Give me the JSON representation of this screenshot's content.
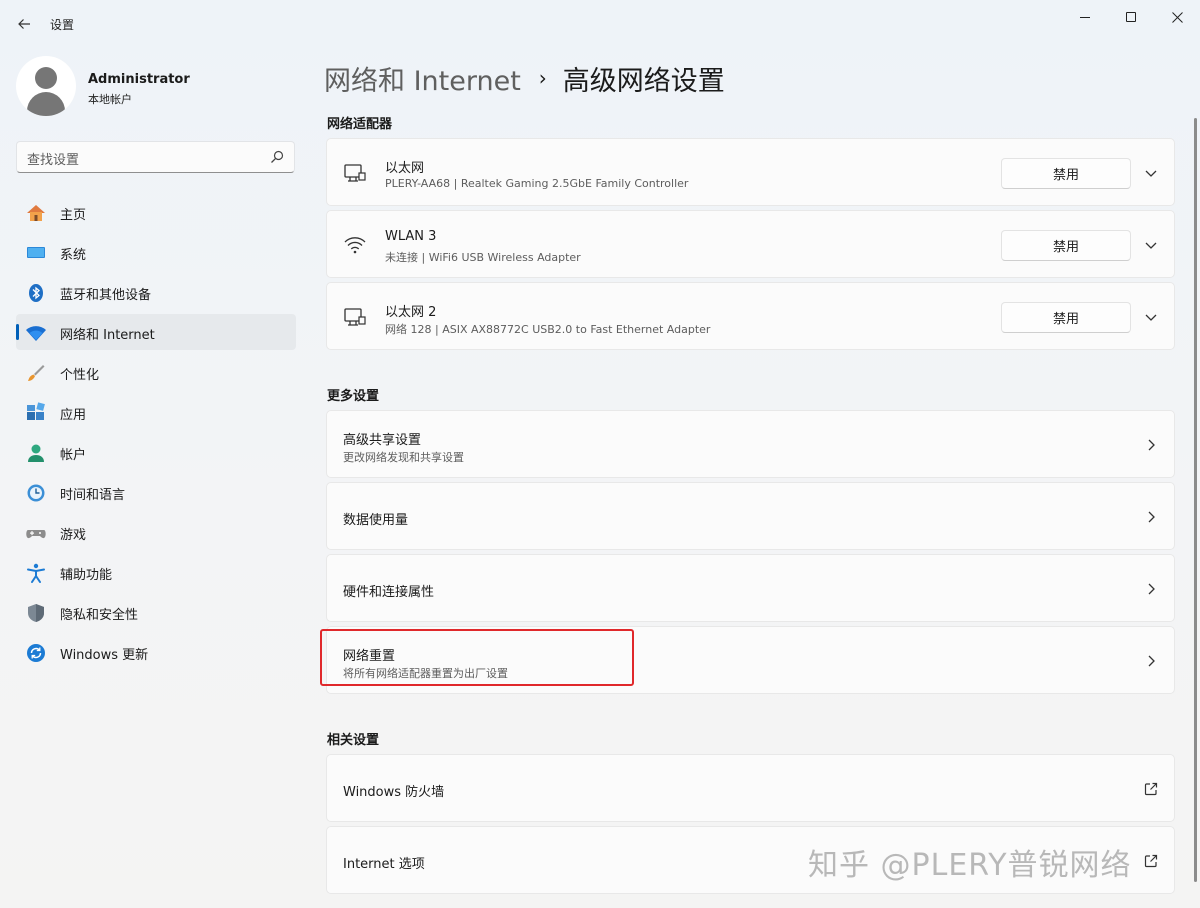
{
  "titlebar": {
    "app_title": "设置"
  },
  "profile": {
    "name": "Administrator",
    "account_type": "本地帐户"
  },
  "search": {
    "placeholder": "查找设置"
  },
  "nav": {
    "items": [
      {
        "label": "主页",
        "icon": "home-icon"
      },
      {
        "label": "系统",
        "icon": "system-icon"
      },
      {
        "label": "蓝牙和其他设备",
        "icon": "bluetooth-icon"
      },
      {
        "label": "网络和 Internet",
        "icon": "wifi-icon",
        "active": true
      },
      {
        "label": "个性化",
        "icon": "brush-icon"
      },
      {
        "label": "应用",
        "icon": "apps-icon"
      },
      {
        "label": "帐户",
        "icon": "account-icon"
      },
      {
        "label": "时间和语言",
        "icon": "clock-globe-icon"
      },
      {
        "label": "游戏",
        "icon": "gamepad-icon"
      },
      {
        "label": "辅助功能",
        "icon": "accessibility-icon"
      },
      {
        "label": "隐私和安全性",
        "icon": "shield-icon"
      },
      {
        "label": "Windows 更新",
        "icon": "update-icon"
      }
    ]
  },
  "breadcrumb": {
    "parent": "网络和 Internet",
    "separator": "›",
    "current": "高级网络设置"
  },
  "sections": {
    "adapters": "网络适配器",
    "more": "更多设置",
    "related": "相关设置"
  },
  "adapters": [
    {
      "name": "以太网",
      "detail": "PLERY-AA68 | Realtek Gaming 2.5GbE Family Controller",
      "button": "禁用",
      "icon": "ethernet-icon"
    },
    {
      "name": "WLAN 3",
      "detail": "未连接 | WiFi6 USB Wireless Adapter",
      "button": "禁用",
      "icon": "wifi-icon"
    },
    {
      "name": "以太网 2",
      "detail": "网络 128 | ASIX AX88772C USB2.0 to Fast Ethernet Adapter",
      "button": "禁用",
      "icon": "ethernet-icon"
    }
  ],
  "more_settings": [
    {
      "title": "高级共享设置",
      "subtitle": "更改网络发现和共享设置"
    },
    {
      "title": "数据使用量",
      "subtitle": ""
    },
    {
      "title": "硬件和连接属性",
      "subtitle": ""
    },
    {
      "title": "网络重置",
      "subtitle": "将所有网络适配器重置为出厂设置"
    }
  ],
  "related_settings": [
    {
      "title": "Windows 防火墙",
      "icon": "open-external-icon"
    },
    {
      "title": "Internet 选项",
      "icon": "open-external-icon"
    }
  ],
  "watermark": "知乎 @PLERY普锐网络",
  "colors": {
    "accent": "#005fb8",
    "highlight_box": "#e0282b"
  }
}
